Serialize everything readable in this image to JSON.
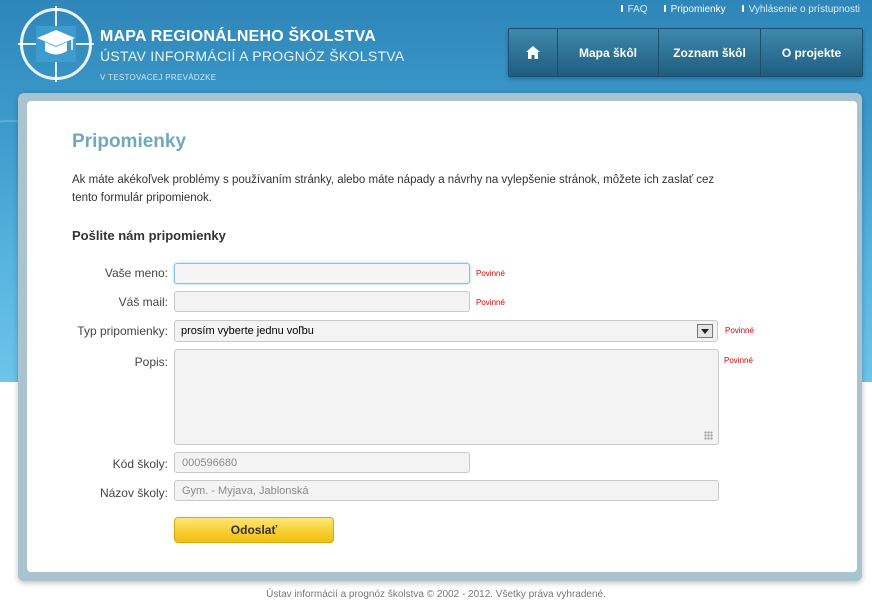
{
  "brand": {
    "title": "MAPA REGIONÁLNEHO ŠKOLSTVA",
    "subtitle": "ÚSTAV INFORMÁCIÍ A PROGNÓZ ŠKOLSTVA",
    "note": "V TESTOVACEJ PREVÁDZKE"
  },
  "toplinks": [
    {
      "label": "FAQ"
    },
    {
      "label": "Pripomienky"
    },
    {
      "label": "Vyhlásenie o prístupnosti"
    }
  ],
  "nav": {
    "home_icon": "home-icon",
    "items": [
      {
        "label": "Mapa škôl"
      },
      {
        "label": "Zoznam škôl"
      },
      {
        "label": "O projekte"
      }
    ]
  },
  "page": {
    "title": "Pripomienky",
    "intro": "Ak máte akékoľvek problémy s používaním stránky, alebo máte nápady a návrhy na vylepšenie stránok, môžete ich zaslať cez tento formulár pripomienok.",
    "section_title": "Pošlite nám pripomienky"
  },
  "form": {
    "required_text": "Povinné",
    "name": {
      "label": "Vaše meno:",
      "value": ""
    },
    "email": {
      "label": "Váš mail:",
      "value": ""
    },
    "type": {
      "label": "Typ pripomienky:",
      "selected": "prosím vyberte jednu voľbu"
    },
    "description": {
      "label": "Popis:",
      "value": ""
    },
    "school_code": {
      "label": "Kód školy:",
      "value": "000596680"
    },
    "school_name": {
      "label": "Názov školy:",
      "value": "Gym. - Myjava, Jablonská"
    },
    "submit_label": "Odoslať"
  },
  "footer": {
    "text": "Ústav informácií a prognóz školstva © 2002 - 2012. Všetky práva vyhradené."
  },
  "colors": {
    "header_blue": "#3d9ccd",
    "nav_dark": "#1f5d80",
    "title_blue": "#6ea9be",
    "required_red": "#e10000",
    "button_yellow": "#f8cf33"
  }
}
